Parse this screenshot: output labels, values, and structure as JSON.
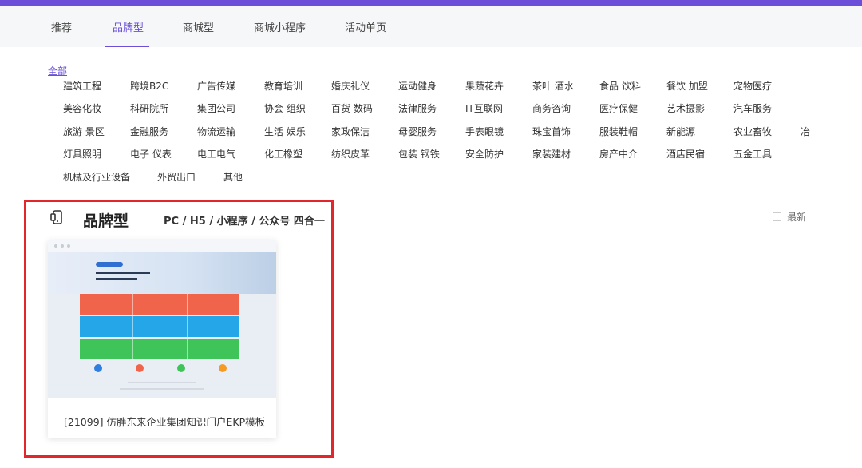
{
  "colors": {
    "accent": "#6b4fd8",
    "highlight": "#e3262b"
  },
  "tabs": [
    {
      "label": "推荐"
    },
    {
      "label": "品牌型",
      "active": true
    },
    {
      "label": "商城型"
    },
    {
      "label": "商城小程序"
    },
    {
      "label": "活动单页"
    }
  ],
  "categories": {
    "all": "全部",
    "row1": [
      "建筑工程",
      "跨境B2C",
      "广告传媒",
      "教育培训",
      "婚庆礼仪",
      "运动健身",
      "果蔬花卉",
      "茶叶 酒水",
      "食品 饮料",
      "餐饮 加盟",
      "宠物医疗"
    ],
    "row2": [
      "美容化妆",
      "科研院所",
      "集团公司",
      "协会 组织",
      "百货 数码",
      "法律服务",
      "IT互联网",
      "商务咨询",
      "医疗保健",
      "艺术摄影",
      "汽车服务"
    ],
    "row3": [
      "旅游 景区",
      "金融服务",
      "物流运输",
      "生活 娱乐",
      "家政保洁",
      "母婴服务",
      "手表眼镜",
      "珠宝首饰",
      "服装鞋帽",
      "新能源",
      "农业畜牧",
      "冶"
    ],
    "row4": [
      "灯具照明",
      "电子 仪表",
      "电工电气",
      "化工橡塑",
      "纺织皮革",
      "包装 钢铁",
      "安全防护",
      "家装建材",
      "房产中介",
      "酒店民宿",
      "五金工具"
    ],
    "row5": [
      "机械及行业设备",
      "外贸出口",
      "其他"
    ]
  },
  "section": {
    "icon": "mobile-template-icon",
    "title": "品牌型",
    "subtitle": "PC / H5 / 小程序 / 公众号 四合一",
    "sort_label": "最新"
  },
  "cards": [
    {
      "title": "[21099] 仿胖东来企业集团知识门户EKP模板"
    }
  ]
}
